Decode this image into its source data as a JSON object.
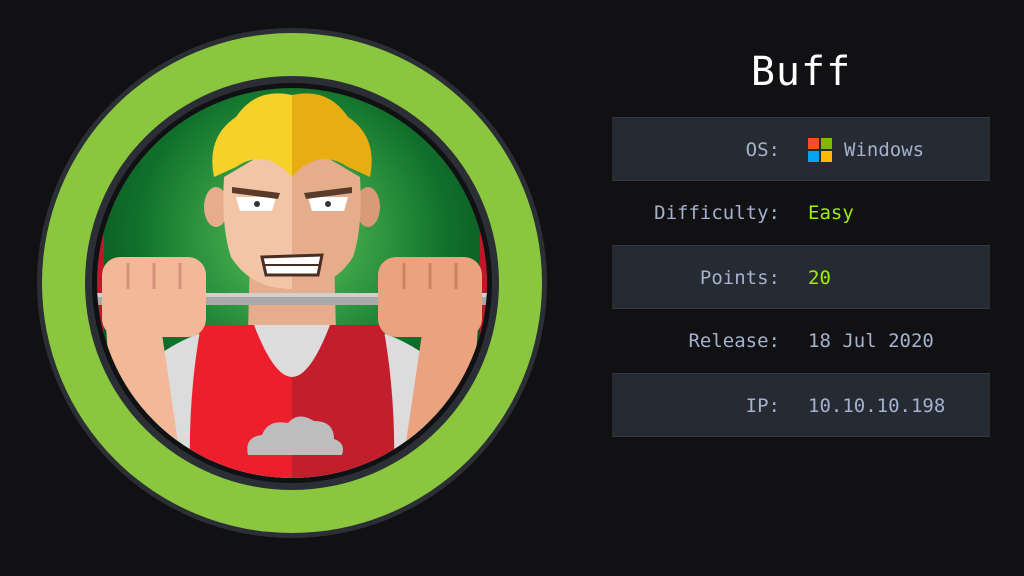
{
  "machine": {
    "name": "Buff"
  },
  "info": {
    "os": {
      "label": "OS:",
      "value": "Windows",
      "icon": "windows-icon"
    },
    "difficulty": {
      "label": "Difficulty:",
      "value": "Easy"
    },
    "points": {
      "label": "Points:",
      "value": "20"
    },
    "release": {
      "label": "Release:",
      "value": "18 Jul 2020"
    },
    "ip": {
      "label": "IP:",
      "value": "10.10.10.198"
    }
  },
  "colors": {
    "background": "#111114",
    "ring": "#8ac73e",
    "accent_green": "#9fef00",
    "label": "#a4b1cd",
    "row_shade": "#262b33"
  },
  "avatar": {
    "icon": "weightlifter-avatar-icon"
  }
}
